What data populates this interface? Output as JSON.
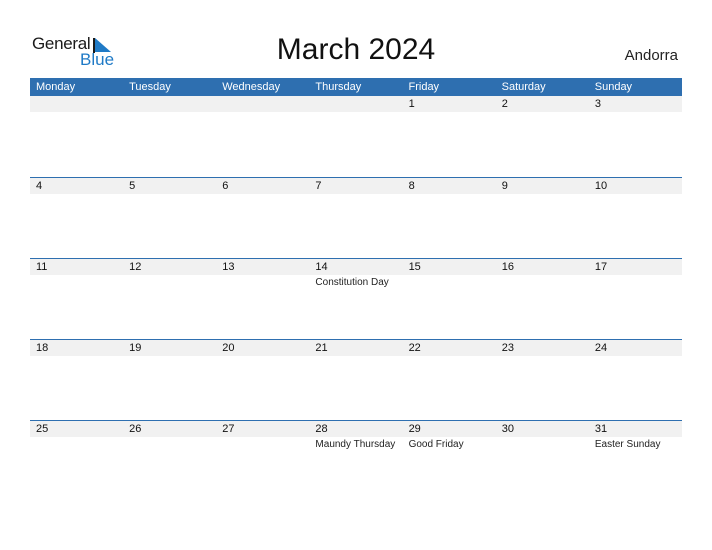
{
  "logo": {
    "text_general": "General",
    "text_blue": "Blue",
    "icon": "triangle-flag-icon"
  },
  "title": "March 2024",
  "country": "Andorra",
  "colors": {
    "header_bg": "#2e6fb0",
    "header_text": "#ffffff",
    "day_strip": "#f1f1f1",
    "logo_blue": "#1f7ac6"
  },
  "weekdays": [
    "Monday",
    "Tuesday",
    "Wednesday",
    "Thursday",
    "Friday",
    "Saturday",
    "Sunday"
  ],
  "weeks": [
    [
      {
        "day": ""
      },
      {
        "day": ""
      },
      {
        "day": ""
      },
      {
        "day": ""
      },
      {
        "day": "1"
      },
      {
        "day": "2"
      },
      {
        "day": "3"
      }
    ],
    [
      {
        "day": "4"
      },
      {
        "day": "5"
      },
      {
        "day": "6"
      },
      {
        "day": "7"
      },
      {
        "day": "8"
      },
      {
        "day": "9"
      },
      {
        "day": "10"
      }
    ],
    [
      {
        "day": "11"
      },
      {
        "day": "12"
      },
      {
        "day": "13"
      },
      {
        "day": "14",
        "holiday": "Constitution Day"
      },
      {
        "day": "15"
      },
      {
        "day": "16"
      },
      {
        "day": "17"
      }
    ],
    [
      {
        "day": "18"
      },
      {
        "day": "19"
      },
      {
        "day": "20"
      },
      {
        "day": "21"
      },
      {
        "day": "22"
      },
      {
        "day": "23"
      },
      {
        "day": "24"
      }
    ],
    [
      {
        "day": "25"
      },
      {
        "day": "26"
      },
      {
        "day": "27"
      },
      {
        "day": "28",
        "holiday": "Maundy Thursday"
      },
      {
        "day": "29",
        "holiday": "Good Friday"
      },
      {
        "day": "30"
      },
      {
        "day": "31",
        "holiday": "Easter Sunday"
      }
    ]
  ]
}
